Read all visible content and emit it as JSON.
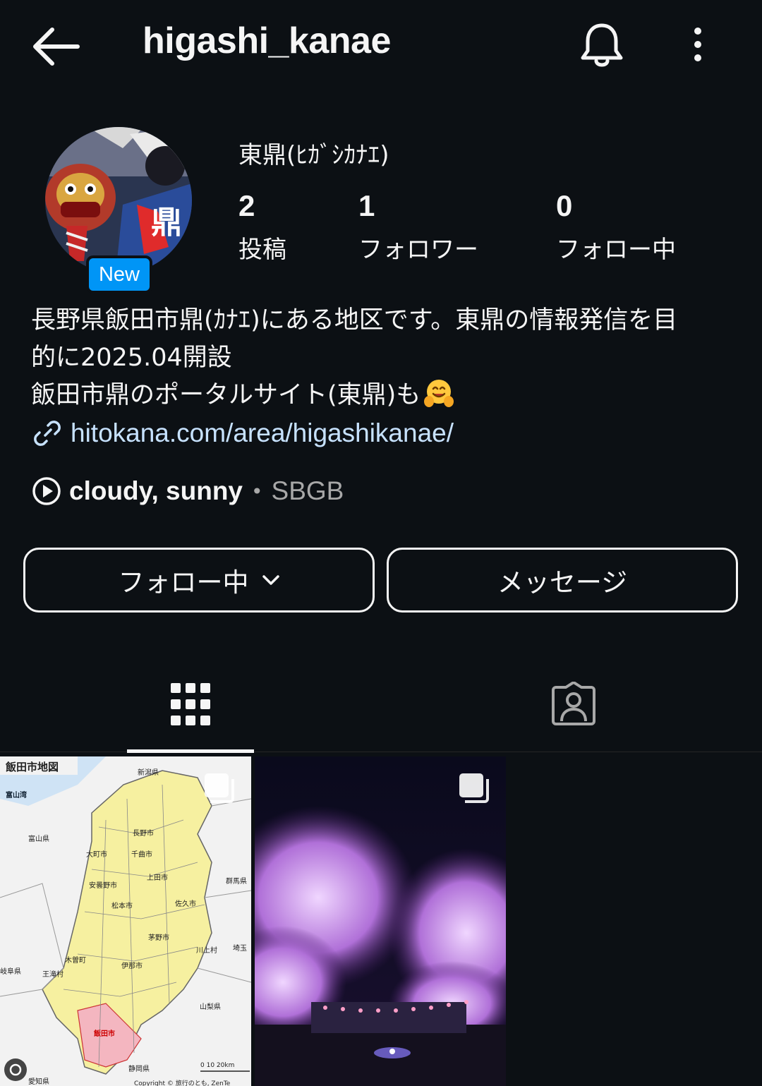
{
  "header": {
    "username": "higashi_kanae",
    "back_icon": "arrow-left-icon",
    "notification_icon": "bell-icon",
    "more_icon": "more-vertical-icon"
  },
  "profile": {
    "display_name": "東鼎(ﾋｶﾞｼｶﾅｴ)",
    "new_badge": "New",
    "stats": [
      {
        "value": "2",
        "label": "投稿"
      },
      {
        "value": "1",
        "label": "フォロワー"
      },
      {
        "value": "0",
        "label": "フォロー中"
      }
    ]
  },
  "bio": {
    "line1": "長野県飯田市鼎(ｶﾅｴ)にある地区です。東鼎の情報発信を目",
    "line2": "的に2025.04開設",
    "line3": "飯田市鼎のポータルサイト(東鼎)も",
    "emoji": "hugging-face-emoji",
    "link": "hitokana.com/area/higashikanae/"
  },
  "music": {
    "title": "cloudy, sunny",
    "separator": "•",
    "artist": "SBGB"
  },
  "buttons": {
    "following": "フォロー中",
    "message": "メッセージ"
  },
  "tabs": [
    {
      "icon": "grid-icon",
      "active": true
    },
    {
      "icon": "tagged-person-icon",
      "active": false
    }
  ],
  "posts": [
    {
      "type": "map-image",
      "multi": true,
      "map_title": "飯田市地図",
      "labels": [
        "新潟県",
        "富山湾",
        "富山県",
        "群馬県",
        "埼玉",
        "岐阜県",
        "山梨県",
        "静岡県",
        "愛知県",
        "長野市",
        "松本市",
        "上田市",
        "佐久市",
        "伊那市",
        "茅野市",
        "大町市",
        "木曽町",
        "王滝村",
        "川上村",
        "飯田市",
        "安曇野市",
        "千曲市"
      ],
      "scale": "0  10  20km",
      "copyright": "Copyright © 旅行のとも, ZenTe"
    },
    {
      "type": "night-cherry-blossoms-photo",
      "multi": true
    }
  ],
  "colors": {
    "background": "#0c1014",
    "text": "#f5f5f5",
    "link": "#c7e2ff",
    "badge": "#0095f6",
    "muted": "#a8a8a8"
  }
}
